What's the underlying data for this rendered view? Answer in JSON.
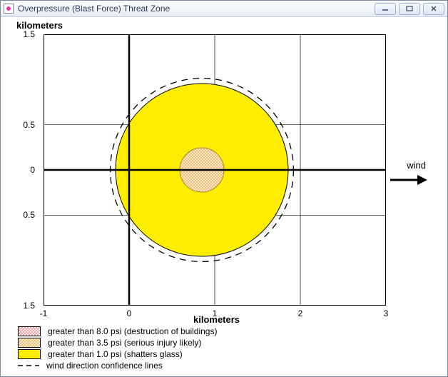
{
  "window": {
    "title": "Overpressure (Blast Force) Threat Zone",
    "buttons": {
      "min": "",
      "max": "",
      "close": ""
    }
  },
  "chart_data": {
    "type": "scatter",
    "title": "Overpressure (Blast Force) Threat Zone",
    "xlabel": "kilometers",
    "ylabel": "kilometers",
    "xlim": [
      -1,
      3
    ],
    "ylim": [
      -1.5,
      1.5
    ],
    "xticks": [
      -1,
      0,
      1,
      2,
      3
    ],
    "yticks": [
      -1.5,
      -0.5,
      0,
      0.5,
      1.5
    ],
    "ytick_labels": [
      "1.5",
      "0.5",
      "0",
      "0.5",
      "1.5"
    ],
    "wind_label": "wind",
    "wind_direction_deg": 0,
    "zones": [
      {
        "name": ">8.0 psi",
        "threshold_psi": 8.0,
        "center_x": 0.85,
        "center_y": 0,
        "radius_km": 0.25,
        "fill": "#fff4e0",
        "pattern": "dots-red",
        "legend": "greater than 8.0 psi (destruction of buildings)"
      },
      {
        "name": ">3.5 psi",
        "threshold_psi": 3.5,
        "center_x": 0.85,
        "center_y": 0,
        "radius_km": 0.25,
        "fill": "#ffe7c0",
        "pattern": "dots-orange",
        "legend": "greater than 3.5 psi (serious injury likely)"
      },
      {
        "name": ">1.0 psi",
        "threshold_psi": 1.0,
        "center_x": 0.85,
        "center_y": 0,
        "radius_km": 1.0,
        "fill": "#ffee00",
        "pattern": "none",
        "legend": "greater than 1.0 psi (shatters glass)"
      }
    ],
    "confidence_lines": {
      "legend": "wind direction confidence lines",
      "center_x": 0.85,
      "center_y": 0,
      "radius_km": 1.07
    },
    "legend_colors": {
      "red": "#ffe6e6",
      "orange": "#fff0d6",
      "yellow": "#ffee00"
    }
  }
}
